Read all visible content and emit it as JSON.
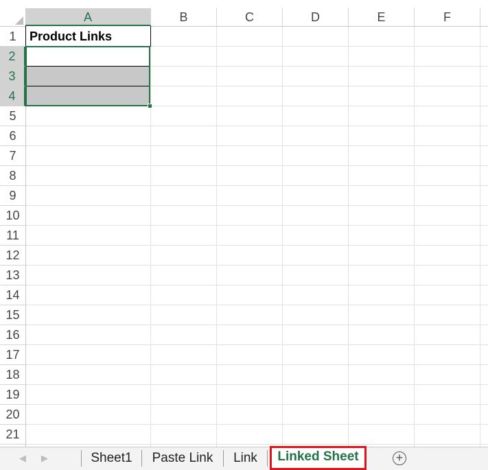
{
  "columns": [
    "A",
    "B",
    "C",
    "D",
    "E",
    "F"
  ],
  "rows": [
    "1",
    "2",
    "3",
    "4",
    "5",
    "6",
    "7",
    "8",
    "9",
    "10",
    "11",
    "12",
    "13",
    "14",
    "15",
    "16",
    "17",
    "18",
    "19",
    "20",
    "21"
  ],
  "cells": {
    "A1": "Product Links"
  },
  "selection": {
    "column": "A",
    "rows": [
      "2",
      "3",
      "4"
    ]
  },
  "tabs": [
    {
      "label": "Sheet1",
      "active": false
    },
    {
      "label": "Paste Link",
      "active": false
    },
    {
      "label": "Link",
      "active": false
    },
    {
      "label": "Linked Sheet",
      "active": true
    }
  ],
  "nav_icons": {
    "prev": "scroll-left-icon",
    "next": "scroll-right-icon",
    "add": "add-sheet-icon"
  },
  "colors": {
    "accent": "#217346",
    "highlight_border": "#e0131a",
    "fill": "#c8c8c8"
  }
}
